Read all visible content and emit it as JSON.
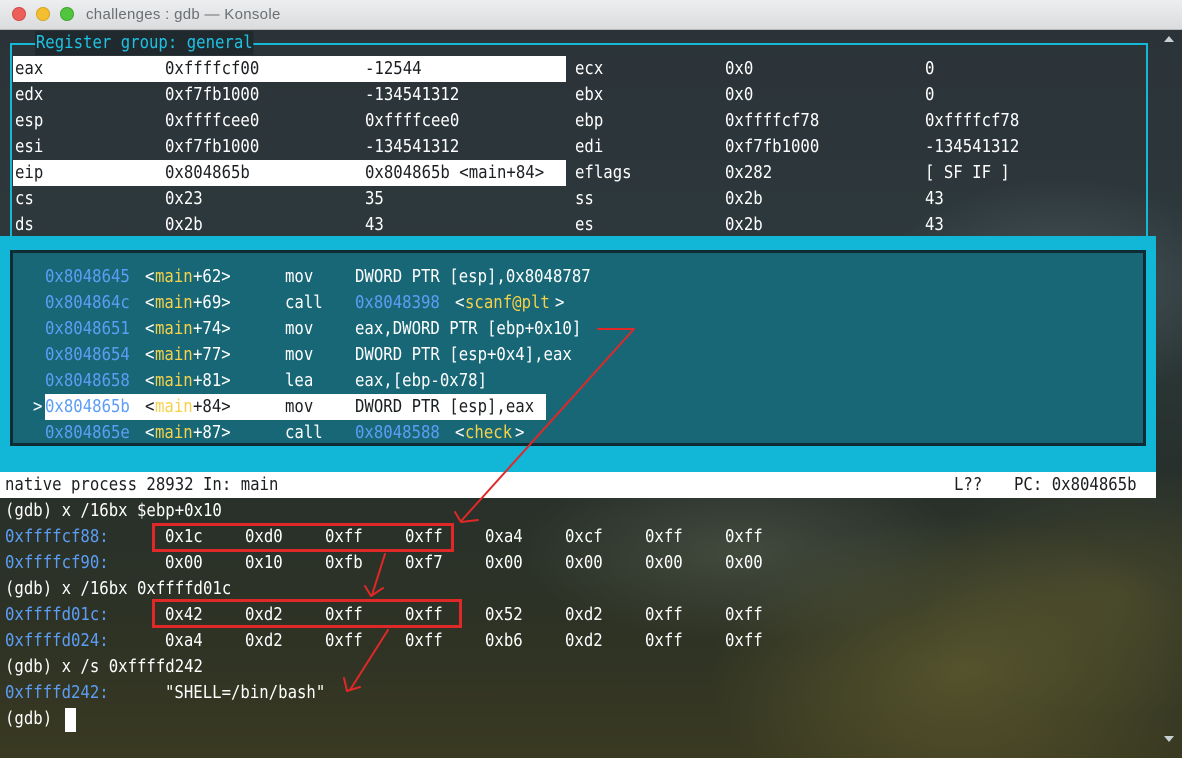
{
  "window": {
    "title": "challenges : gdb — Konsole"
  },
  "registers": {
    "title": "Register group: general",
    "rows": [
      [
        [
          "eax",
          "0xffffcf00",
          "-12544"
        ],
        [
          "ecx",
          "0x0",
          "0"
        ]
      ],
      [
        [
          "edx",
          "0xf7fb1000",
          "-134541312"
        ],
        [
          "ebx",
          "0x0",
          "0"
        ]
      ],
      [
        [
          "esp",
          "0xffffcee0",
          "0xffffcee0"
        ],
        [
          "ebp",
          "0xffffcf78",
          "0xffffcf78"
        ]
      ],
      [
        [
          "esi",
          "0xf7fb1000",
          "-134541312"
        ],
        [
          "edi",
          "0xf7fb1000",
          "-134541312"
        ]
      ],
      [
        [
          "eip",
          "0x804865b",
          "0x804865b <main+84>"
        ],
        [
          "eflags",
          "0x282",
          "[ SF IF ]"
        ]
      ],
      [
        [
          "cs",
          "0x23",
          "35"
        ],
        [
          "ss",
          "0x2b",
          "43"
        ]
      ],
      [
        [
          "ds",
          "0x2b",
          "43"
        ],
        [
          "es",
          "0x2b",
          "43"
        ]
      ]
    ],
    "highlighted": [
      "eax",
      "eip"
    ]
  },
  "disassembly": [
    {
      "marker": "",
      "addr": "0x8048645",
      "sym": "main",
      "off": "+62",
      "op": "mov",
      "args": "DWORD PTR [esp],0x8048787",
      "target": "",
      "tsym": ""
    },
    {
      "marker": "",
      "addr": "0x804864c",
      "sym": "main",
      "off": "+69",
      "op": "call",
      "args": "",
      "target": "0x8048398",
      "tsym": "scanf@plt"
    },
    {
      "marker": "",
      "addr": "0x8048651",
      "sym": "main",
      "off": "+74",
      "op": "mov",
      "args": "eax,DWORD PTR [ebp+0x10]",
      "target": "",
      "tsym": ""
    },
    {
      "marker": "",
      "addr": "0x8048654",
      "sym": "main",
      "off": "+77",
      "op": "mov",
      "args": "DWORD PTR [esp+0x4],eax",
      "target": "",
      "tsym": ""
    },
    {
      "marker": "",
      "addr": "0x8048658",
      "sym": "main",
      "off": "+81",
      "op": "lea",
      "args": "eax,[ebp-0x78]",
      "target": "",
      "tsym": ""
    },
    {
      "marker": ">",
      "addr": "0x804865b",
      "sym": "main",
      "off": "+84",
      "op": "mov",
      "args": "DWORD PTR [esp],eax",
      "target": "",
      "tsym": "",
      "current": true
    },
    {
      "marker": "",
      "addr": "0x804865e",
      "sym": "main",
      "off": "+87",
      "op": "call",
      "args": "",
      "target": "0x8048588",
      "tsym": "check"
    }
  ],
  "status": {
    "process": "native process 28932 In: main",
    "line": "L??",
    "pc": "PC: 0x804865b"
  },
  "console": [
    {
      "type": "cmd",
      "text": "(gdb) x /16bx $ebp+0x10"
    },
    {
      "type": "mem",
      "addr": "0xffffcf88:",
      "bytes": [
        "0x1c",
        "0xd0",
        "0xff",
        "0xff",
        "0xa4",
        "0xcf",
        "0xff",
        "0xff"
      ]
    },
    {
      "type": "mem",
      "addr": "0xffffcf90:",
      "bytes": [
        "0x00",
        "0x10",
        "0xfb",
        "0xf7",
        "0x00",
        "0x00",
        "0x00",
        "0x00"
      ]
    },
    {
      "type": "cmd",
      "text": "(gdb) x /16bx 0xffffd01c"
    },
    {
      "type": "mem",
      "addr": "0xffffd01c:",
      "bytes": [
        "0x42",
        "0xd2",
        "0xff",
        "0xff",
        "0x52",
        "0xd2",
        "0xff",
        "0xff"
      ]
    },
    {
      "type": "mem",
      "addr": "0xffffd024:",
      "bytes": [
        "0xa4",
        "0xd2",
        "0xff",
        "0xff",
        "0xb6",
        "0xd2",
        "0xff",
        "0xff"
      ]
    },
    {
      "type": "cmd",
      "text": "(gdb) x /s 0xffffd242"
    },
    {
      "type": "str",
      "addr": "0xffffd242:",
      "value": "\"SHELL=/bin/bash\""
    },
    {
      "type": "prompt",
      "text": "(gdb) "
    }
  ],
  "colors": {
    "accent": "#14b8d8",
    "address": "#5c9ef5",
    "symbol": "#f6d24a",
    "annotation": "#e02828"
  }
}
